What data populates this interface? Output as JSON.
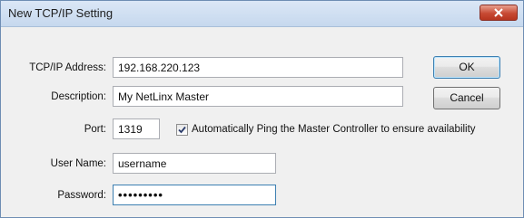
{
  "window": {
    "title": "New TCP/IP Setting",
    "close_icon": "close-x-icon"
  },
  "form": {
    "ip_label": "TCP/IP Address:",
    "ip_value": "192.168.220.123",
    "description_label": "Description:",
    "description_value": "My NetLinx Master",
    "port_label": "Port:",
    "port_value": "1319",
    "ping_checkbox_label": "Automatically Ping the Master Controller to ensure availability",
    "ping_checked": true,
    "username_label": "User Name:",
    "username_value": "username",
    "password_label": "Password:",
    "password_value": "•••••••••"
  },
  "buttons": {
    "ok_label": "OK",
    "cancel_label": "Cancel"
  }
}
